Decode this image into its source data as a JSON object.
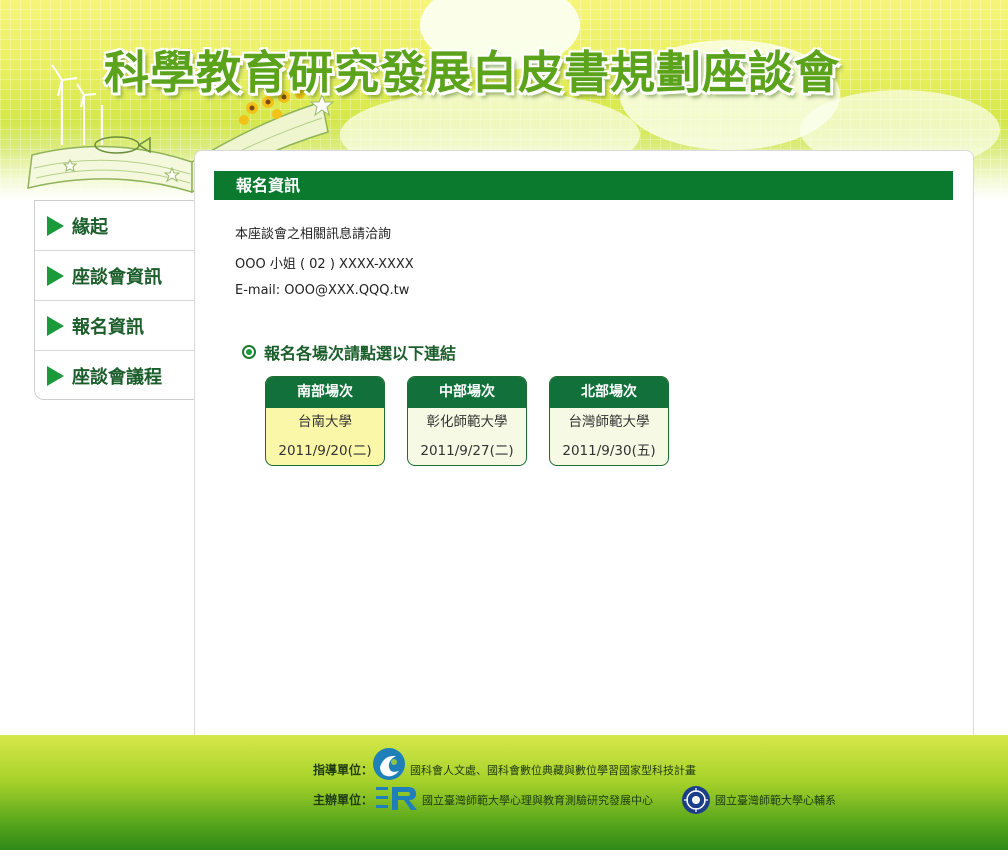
{
  "header": {
    "title": "科學教育研究發展白皮書規劃座談會"
  },
  "sidebar": {
    "items": [
      {
        "label": "緣起"
      },
      {
        "label": "座談會資訊"
      },
      {
        "label": "報名資訊"
      },
      {
        "label": "座談會議程"
      }
    ]
  },
  "main": {
    "section_title": "報名資訊",
    "info": [
      "本座談會之相關訊息請洽詢",
      "OOO 小姐 ( 02 ) XXXX-XXXX",
      "E-mail: OOO@XXX.QQQ.tw"
    ],
    "subheading": "報名各場次請點選以下連結",
    "sessions": [
      {
        "region": "南部場次",
        "venue": "台南大學",
        "date": "2011/9/20(二)"
      },
      {
        "region": "中部場次",
        "venue": "彰化師範大學",
        "date": "2011/9/27(二)"
      },
      {
        "region": "北部場次",
        "venue": "台灣師範大學",
        "date": "2011/9/30(五)"
      }
    ]
  },
  "footer": {
    "guide_label": "指導單位：",
    "guide_text": "國科會人文處、國科會數位典藏與數位學習國家型科技計畫",
    "host_label": "主辦單位：",
    "host_text_1": "國立臺灣師範大學心理與教育測驗研究發展中心",
    "host_text_2": "國立臺灣師範大學心輔系"
  },
  "colors": {
    "accent_green": "#0b7a2f",
    "first_card_bg": "#fbf7a8",
    "card_bg": "#f6f9e4"
  }
}
